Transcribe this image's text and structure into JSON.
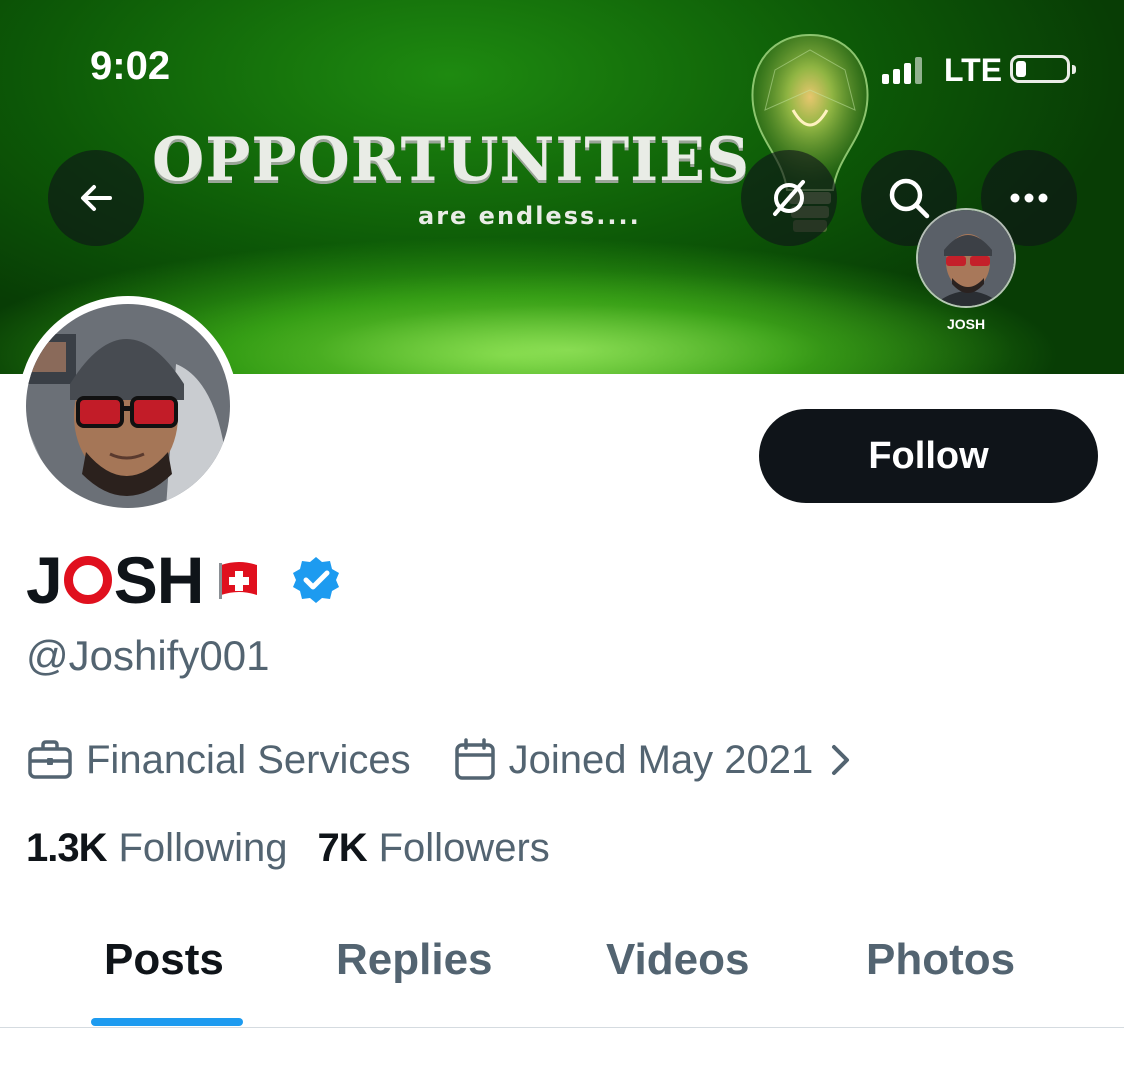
{
  "status_bar": {
    "time": "9:02",
    "network": "LTE"
  },
  "banner": {
    "title": "OPPORTUNITIES",
    "subtitle": "are endless....",
    "mini_profile_label": "JOSH",
    "icons": [
      "back-arrow-icon",
      "grok-icon",
      "search-icon",
      "more-icon"
    ]
  },
  "profile": {
    "display_name_prefix": "J",
    "display_name_suffix": "SH",
    "handle": "@Joshify001",
    "category": "Financial Services",
    "joined": "Joined May 2021",
    "following_count": "1.3K",
    "following_label": "Following",
    "followers_count": "7K",
    "followers_label": "Followers",
    "follow_button": "Follow",
    "verified": true
  },
  "tabs": [
    {
      "label": "Posts",
      "active": true
    },
    {
      "label": "Replies",
      "active": false
    },
    {
      "label": "Videos",
      "active": false
    },
    {
      "label": "Photos",
      "active": false
    }
  ],
  "colors": {
    "accent": "#1d9bf0",
    "text_primary": "#0f1419",
    "text_secondary": "#536471",
    "banner_green": "#1e8a10",
    "name_ring_red": "#e0101e"
  }
}
